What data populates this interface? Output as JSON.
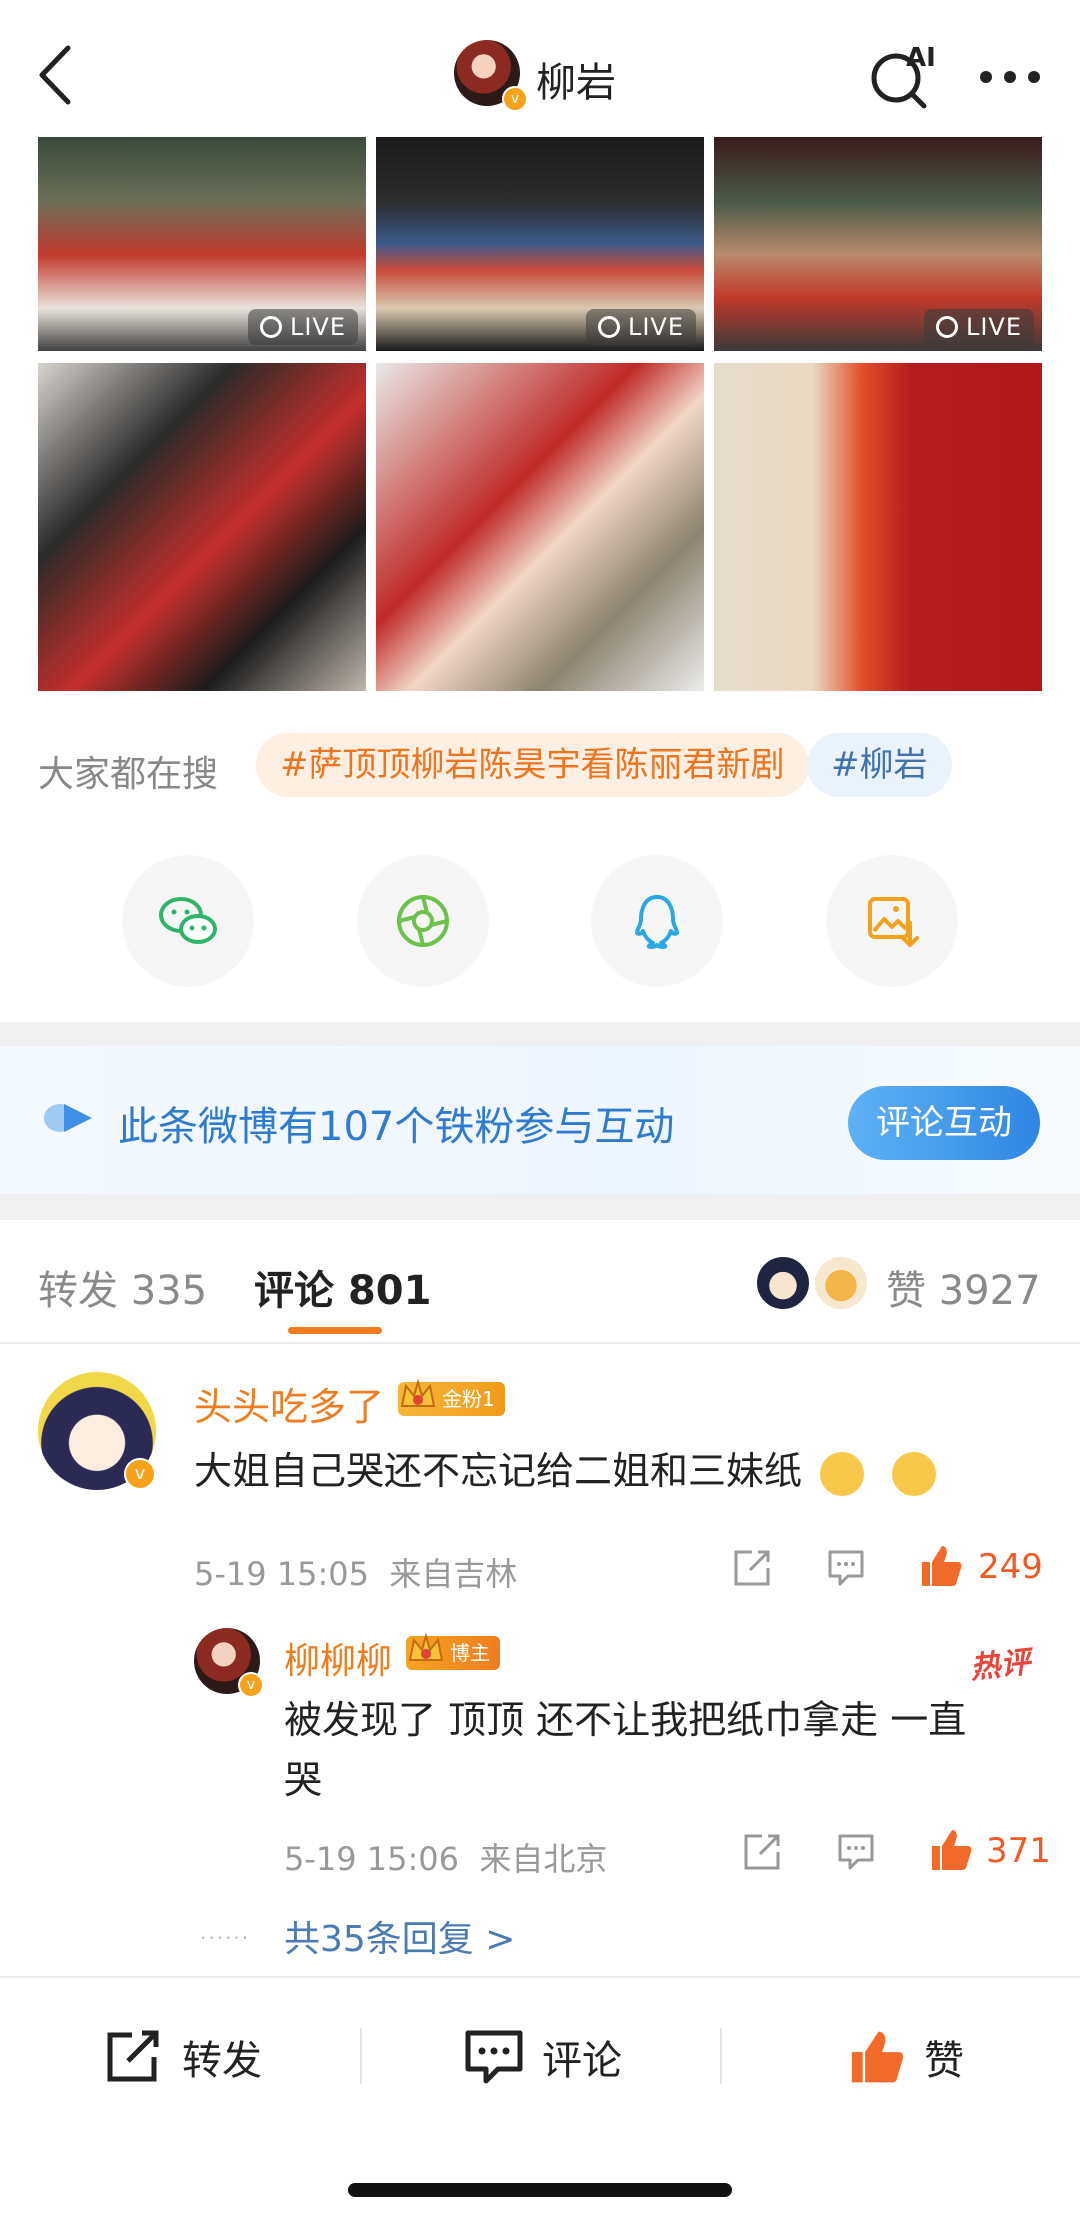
{
  "header": {
    "title": "柳岩",
    "ai_label": "AI"
  },
  "photos": {
    "live_label": "LIVE"
  },
  "search": {
    "label": "大家都在搜",
    "tags": [
      "#萨顶顶柳岩陈昊宇看陈丽君新剧",
      "#柳岩"
    ]
  },
  "share": {
    "icons": [
      "wechat-icon",
      "moments-icon",
      "qq-icon",
      "save-image-icon"
    ],
    "colors": [
      "#2fb56a",
      "#6cc24a",
      "#2aa8e6",
      "#f5a11c"
    ]
  },
  "fans": {
    "text": "此条微博有107个铁粉参与互动",
    "button": "评论互动"
  },
  "tabs": {
    "repost_label": "转发",
    "repost_count": "335",
    "comment_label": "评论",
    "comment_count": "801",
    "like_label": "赞",
    "like_count": "3927"
  },
  "comments": [
    {
      "user": "头头吃多了",
      "badge": "金粉1",
      "text": "大姐自己哭还不忘记给二姐和三妹纸",
      "time": "5-19 15:05",
      "location": "来自吉林",
      "likes": "249",
      "reply": {
        "user": "柳柳柳",
        "badge": "博主",
        "hot": "热评",
        "text_line1": "被发现了 顶顶 还不让我把纸巾拿走 一直",
        "text_line2": "哭",
        "time": "5-19 15:06",
        "location": "来自北京",
        "likes": "371"
      },
      "more_replies": "共35条回复 >"
    }
  ],
  "bottom_bar": {
    "repost": "转发",
    "comment": "评论",
    "like": "赞"
  },
  "colors": {
    "accent": "#f07c1e",
    "link": "#2f7bd1",
    "like": "#f05a23"
  }
}
